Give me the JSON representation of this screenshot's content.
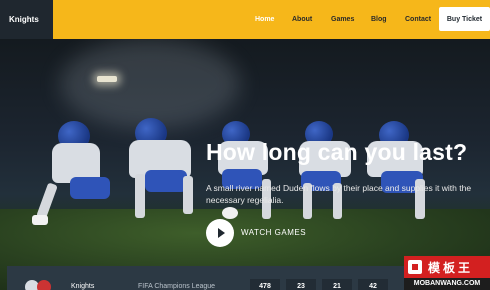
{
  "header": {
    "logo": "Knights",
    "nav": [
      {
        "label": "Home"
      },
      {
        "label": "About"
      },
      {
        "label": "Games"
      },
      {
        "label": "Blog"
      },
      {
        "label": "Contact"
      }
    ],
    "cta": "Buy Ticket",
    "accent": "#f6b71a"
  },
  "hero": {
    "title": "How long can you last?",
    "subtitle": "A small river named Duden flows by their place and supplies it with the necessary regelialia.",
    "watch_label": "WATCH GAMES",
    "play_icon": "play-icon"
  },
  "scoreboard": {
    "team": "Knights",
    "league": "FIFA Champions League",
    "stats": [
      "478",
      "23",
      "21",
      "42"
    ]
  },
  "watermark": {
    "cn": "模板王",
    "url": "MOBANWANG.COM"
  }
}
